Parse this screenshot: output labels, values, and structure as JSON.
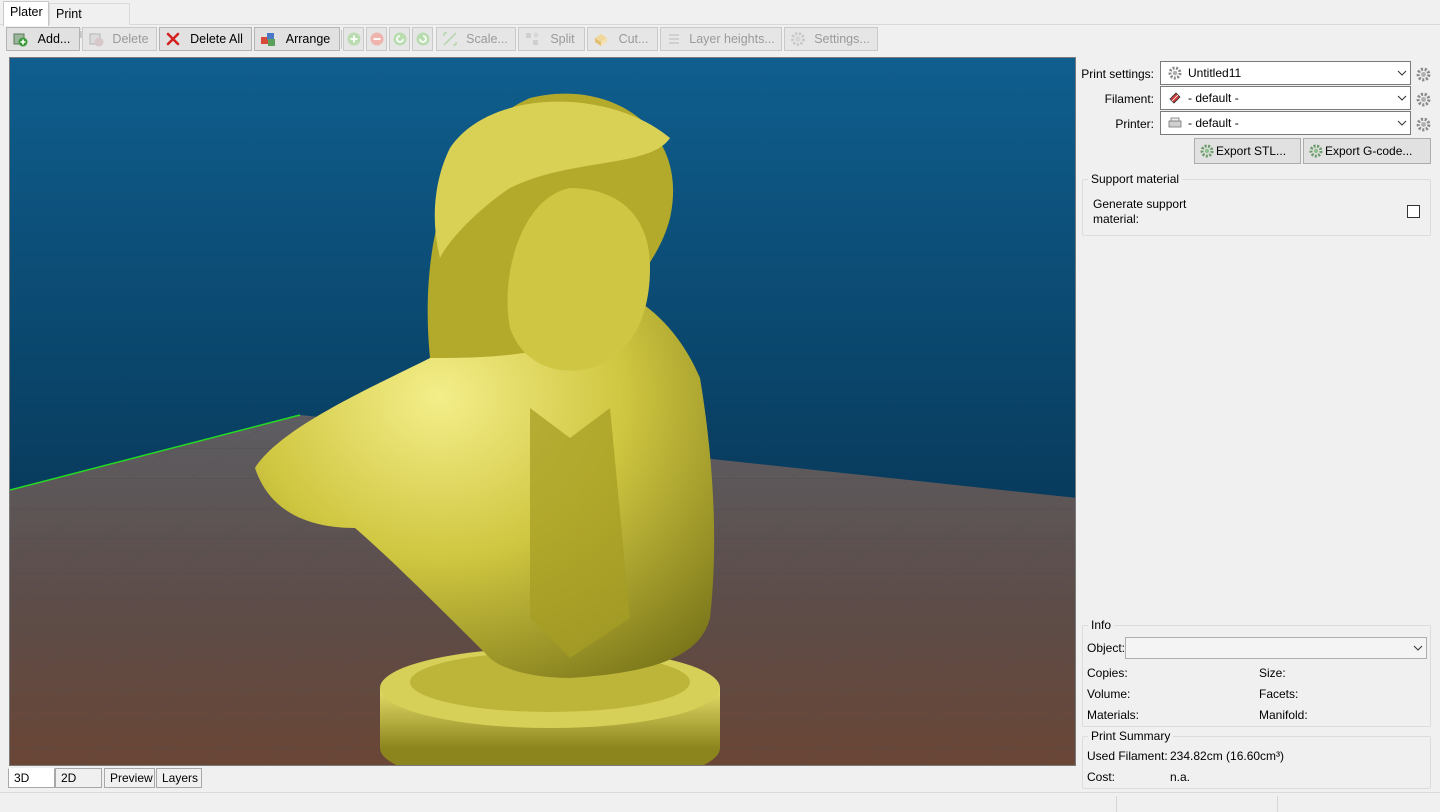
{
  "tabs": [
    {
      "label": "Plater",
      "active": true
    },
    {
      "label": "Print Settings",
      "active": false
    }
  ],
  "toolbar": {
    "add": {
      "label": "Add...",
      "icon": "add-object-icon"
    },
    "delete": {
      "label": "Delete",
      "icon": "delete-object-icon",
      "enabled": false
    },
    "delete_all": {
      "label": "Delete All",
      "icon": "red-x-icon"
    },
    "arrange": {
      "label": "Arrange",
      "icon": "arrange-icon"
    },
    "more": {
      "icon": "plus-circle-icon",
      "enabled": false
    },
    "fewer": {
      "icon": "minus-circle-icon",
      "enabled": false
    },
    "rotate_ccw": {
      "icon": "rotate-ccw-icon",
      "enabled": false
    },
    "rotate_cw": {
      "icon": "rotate-cw-icon",
      "enabled": false
    },
    "scale": {
      "label": "Scale...",
      "icon": "scale-icon",
      "enabled": false
    },
    "split": {
      "label": "Split",
      "icon": "split-icon",
      "enabled": false
    },
    "cut": {
      "label": "Cut...",
      "icon": "cut-icon",
      "enabled": false
    },
    "layer_heights": {
      "label": "Layer heights...",
      "icon": "layers-icon",
      "enabled": false
    },
    "settings": {
      "label": "Settings...",
      "icon": "gear-icon",
      "enabled": false
    }
  },
  "view_tabs": [
    {
      "label": "3D",
      "active": true
    },
    {
      "label": "2D",
      "active": false
    },
    {
      "label": "Preview",
      "active": false
    },
    {
      "label": "Layers",
      "active": false
    }
  ],
  "panel": {
    "print_settings": {
      "label": "Print settings:",
      "value": "Untitled11",
      "icon": "gear-icon"
    },
    "filament": {
      "label": "Filament:",
      "value": "- default -",
      "icon": "spool-icon"
    },
    "printer": {
      "label": "Printer:",
      "value": "- default -",
      "icon": "printer-icon"
    },
    "export_stl": "Export STL...",
    "export_gcode": "Export G-code..."
  },
  "support": {
    "title": "Support material",
    "generate_label_line1": "Generate support",
    "generate_label_line2": "material:",
    "generate_checked": false
  },
  "info": {
    "title": "Info",
    "object_label": "Object:",
    "object_value": "",
    "copies_label": "Copies:",
    "size_label": "Size:",
    "volume_label": "Volume:",
    "facets_label": "Facets:",
    "materials_label": "Materials:",
    "manifold_label": "Manifold:"
  },
  "summary": {
    "title": "Print Summary",
    "used_filament_label": "Used Filament:",
    "used_filament_value": "234.82cm (16.60cm³)",
    "cost_label": "Cost:",
    "cost_value": "n.a."
  },
  "colors": {
    "sky_top": "#0e5a88",
    "sky_bottom": "#062a45",
    "bed_near": "#6a4a3c",
    "bed_far": "#5a5a5e",
    "bed_edge": "#22dd22",
    "model": "#c8c23c"
  }
}
